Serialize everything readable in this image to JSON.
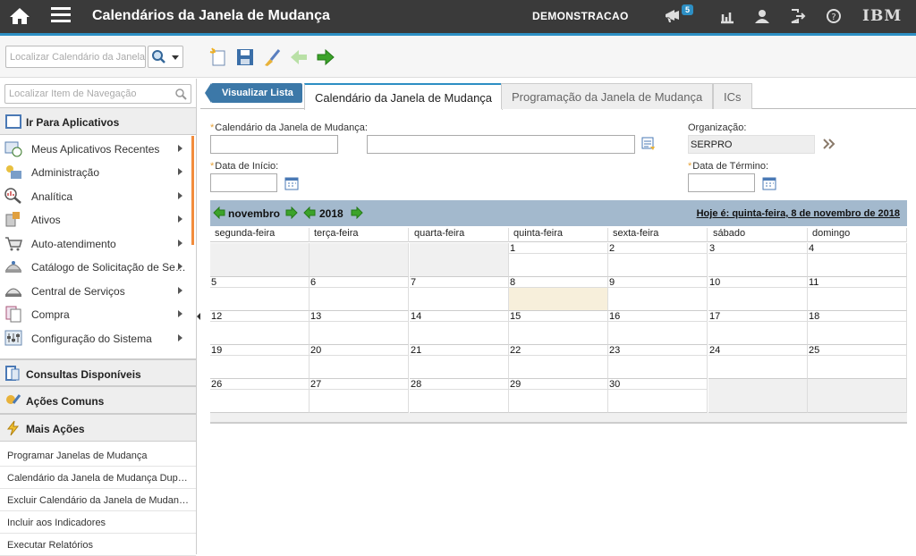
{
  "app": {
    "title": "Calendários da Janela de Mudança",
    "user": "DEMONSTRACAO",
    "notifications": "5",
    "brand": "IBM"
  },
  "toolbar": {
    "search_placeholder": "Localizar Calendário da Janela"
  },
  "sidebar": {
    "search_placeholder": "Localizar Item de Navegação",
    "goto_title": "Ir Para Aplicativos",
    "items": [
      {
        "label": "Meus Aplicativos Recentes",
        "icon": "recent-apps-icon"
      },
      {
        "label": "Administração",
        "icon": "administration-icon"
      },
      {
        "label": "Analítica",
        "icon": "analytics-icon"
      },
      {
        "label": "Ativos",
        "icon": "assets-icon"
      },
      {
        "label": "Auto-atendimento",
        "icon": "self-service-icon"
      },
      {
        "label": "Catálogo de Solicitação de Se…",
        "icon": "catalog-icon"
      },
      {
        "label": "Central de Serviços",
        "icon": "service-desk-icon"
      },
      {
        "label": "Compra",
        "icon": "purchase-icon"
      },
      {
        "label": "Configuração do Sistema",
        "icon": "system-config-icon"
      }
    ],
    "queries_title": "Consultas Disponíveis",
    "common_actions_title": "Ações Comuns",
    "more_actions_title": "Mais Ações",
    "more_actions": [
      "Programar Janelas de Mudança",
      "Calendário da Janela de Mudança Dup…",
      "Excluir Calendário da Janela de Mudan…",
      "Incluir aos Indicadores",
      "Executar Relatórios"
    ]
  },
  "tabs": {
    "view_list": "Visualizar Lista",
    "items": [
      "Calendário da Janela de Mudança",
      "Programação da Janela de Mudança",
      "ICs"
    ],
    "active": 0
  },
  "form": {
    "calendar_label": "Calendário da Janela de Mudança:",
    "calendar_value": "",
    "calendar_desc_value": "",
    "org_label": "Organização:",
    "org_value": "SERPRO",
    "start_label": "Data de Início:",
    "start_value": "",
    "end_label": "Data de Término:",
    "end_value": ""
  },
  "calendar": {
    "month": "novembro",
    "year": "2018",
    "today_text": "Hoje é: quinta-feira, 8 de novembro de 2018",
    "day_names": [
      "segunda-feira",
      "terça-feira",
      "quarta-feira",
      "quinta-feira",
      "sexta-feira",
      "sábado",
      "domingo"
    ],
    "weeks": [
      [
        "",
        "",
        "",
        "1",
        "2",
        "3",
        "4"
      ],
      [
        "5",
        "6",
        "7",
        "8",
        "9",
        "10",
        "11"
      ],
      [
        "12",
        "13",
        "14",
        "15",
        "16",
        "17",
        "18"
      ],
      [
        "19",
        "20",
        "21",
        "22",
        "23",
        "24",
        "25"
      ],
      [
        "26",
        "27",
        "28",
        "29",
        "30",
        "",
        ""
      ]
    ],
    "today_day": "8",
    "colors": {
      "header": "#a3b9cd",
      "today": "#f7efdb",
      "accent": "#2d8fc4"
    }
  }
}
